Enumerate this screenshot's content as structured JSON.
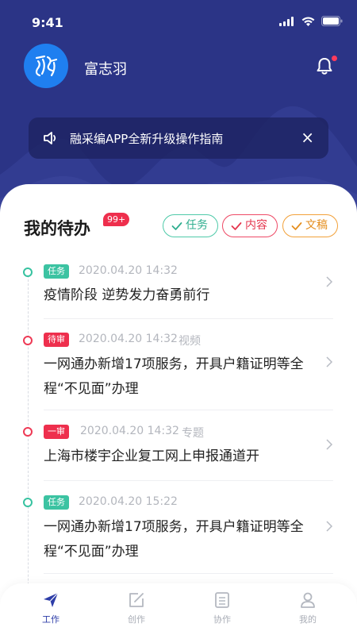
{
  "status_bar": {
    "time": "9:41"
  },
  "user": {
    "name": "富志羽",
    "avatar_icon": "calligraphy-logo-icon"
  },
  "notice": {
    "text": "融采编APP全新升级操作指南",
    "close_label": "×"
  },
  "todo": {
    "title": "我的待办",
    "count_badge": "99+",
    "filters": [
      {
        "label": "任务",
        "color": "#2fae8f"
      },
      {
        "label": "内容",
        "color": "#e5374f"
      },
      {
        "label": "文稿",
        "color": "#e58f20"
      }
    ],
    "items": [
      {
        "tag": "任务",
        "datetime": "2020.04.20 14:32",
        "type": "",
        "title": "疫情阶段 逆势发力奋勇前行",
        "status_color": "#37c2a0"
      },
      {
        "tag": "待审",
        "datetime": "2020.04.20 14:32",
        "type": "视频",
        "title": "一网通办新增17项服务，开具户籍证明等全程“不见面”办理",
        "status_color": "#ee3a55"
      },
      {
        "tag": "一审",
        "datetime": "2020.04.20 14:32",
        "type": "专题",
        "title": "上海市楼宇企业复工网上申报通道开",
        "status_color": "#ee3a55"
      },
      {
        "tag": "任务",
        "datetime": "2020.04.20 15:22",
        "type": "",
        "title": "一网通办新增17项服务，开具户籍证明等全程“不见面”办理",
        "status_color": "#37c2a0"
      }
    ]
  },
  "tabbar": {
    "tabs": [
      {
        "label": "工作",
        "active": true,
        "icon": "paper-plane-icon"
      },
      {
        "label": "创作",
        "active": false,
        "icon": "edit-icon"
      },
      {
        "label": "协作",
        "active": false,
        "icon": "document-icon"
      },
      {
        "label": "我的",
        "active": false,
        "icon": "person-icon"
      }
    ]
  },
  "colors": {
    "header_bg": "#2b3486",
    "accent": "#2d3da8"
  }
}
